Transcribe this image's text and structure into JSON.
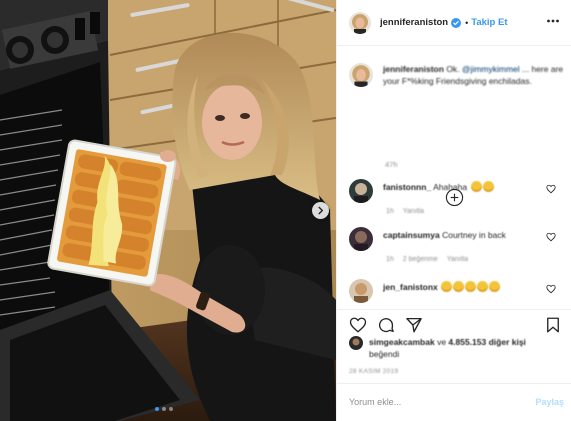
{
  "header": {
    "username": "jenniferaniston",
    "separator": "•",
    "follow_label": "Takip Et"
  },
  "caption": {
    "username": "jenniferaniston",
    "mention": "@jimmykimmel",
    "text_before": "Ok.",
    "text_after": "... here are your F*%king Friendsgiving enchiladas.",
    "time": "47h"
  },
  "comments": [
    {
      "username": "fanistonnn_",
      "text": "Ahahaha",
      "emoji_count": 2,
      "time": "1h",
      "reply_label": "Yanıtla",
      "likes": ""
    },
    {
      "username": "captainsumya",
      "text": "Courtney in back",
      "emoji_count": 0,
      "time": "1h",
      "likes": "2 beğenme",
      "reply_label": "Yanıtla"
    },
    {
      "username": "jen_fanistonx",
      "text": "",
      "emoji_count": 5,
      "time": "",
      "likes": "",
      "reply_label": ""
    }
  ],
  "likes": {
    "liker": "simgeakcambak",
    "connector": "ve",
    "others": "4.855.153 diğer kişi",
    "suffix": "beğendi"
  },
  "post_date": "28 KASIM 2019",
  "add_comment": {
    "placeholder": "Yorum ekle...",
    "post_label": "Paylaş"
  },
  "colors": {
    "accent": "#3897f0",
    "verified": "#3897f0",
    "post_disabled": "#b2dffc",
    "muted_text": "#8e8e8e",
    "divider": "#efefef"
  },
  "icons": [
    "more-options-icon",
    "verified-badge-icon",
    "load-more-comments-icon",
    "heart-icon",
    "comment-icon",
    "share-icon",
    "bookmark-icon",
    "next-photo-icon"
  ],
  "carousel": {
    "slide_count": 3,
    "active_slide": 1
  }
}
